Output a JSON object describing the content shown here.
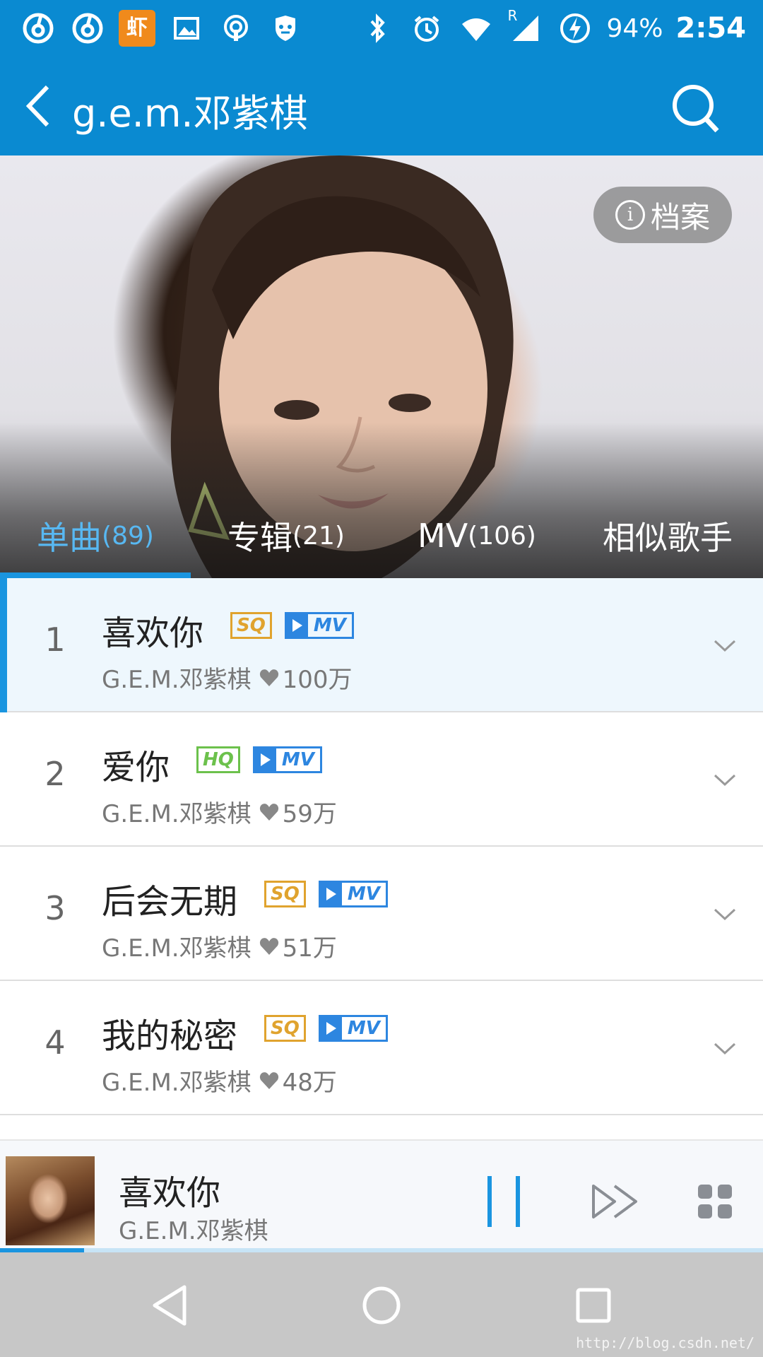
{
  "status_bar": {
    "left_icons": [
      "netease-music-icon",
      "netease-music-icon",
      "xiami-icon",
      "image-icon",
      "podcast-icon",
      "shield-icon"
    ],
    "xiami_label": "虾",
    "right_icons": [
      "bluetooth-icon",
      "alarm-icon",
      "wifi-icon",
      "signal-icon",
      "battery-charging-icon"
    ],
    "roaming": "R",
    "battery": "94%",
    "time": "2:54"
  },
  "header": {
    "title": "g.e.m.邓紫棋"
  },
  "hero": {
    "profile_label": "档案",
    "tabs": [
      {
        "name": "单曲",
        "count": "(89)",
        "active": true
      },
      {
        "name": "专辑",
        "count": "(21)",
        "active": false
      },
      {
        "name": "MV",
        "count": "(106)",
        "active": false
      },
      {
        "name": "相似歌手",
        "count": "",
        "active": false
      }
    ]
  },
  "songs": [
    {
      "num": "1",
      "title": "喜欢你",
      "quality": "SQ",
      "mv": "MV",
      "artist": "G.E.M.邓紫棋",
      "likes": "100万",
      "current": true
    },
    {
      "num": "2",
      "title": "爱你",
      "quality": "HQ",
      "mv": "MV",
      "artist": "G.E.M.邓紫棋",
      "likes": "59万",
      "current": false
    },
    {
      "num": "3",
      "title": "后会无期",
      "quality": "SQ",
      "mv": "MV",
      "artist": "G.E.M.邓紫棋",
      "likes": "51万",
      "current": false
    },
    {
      "num": "4",
      "title": "我的秘密",
      "quality": "SQ",
      "mv": "MV",
      "artist": "G.E.M.邓紫棋",
      "likes": "48万",
      "current": false
    }
  ],
  "player": {
    "title": "喜欢你",
    "artist": "G.E.M.邓紫棋",
    "progress": 0.11
  },
  "watermark": "http://blog.csdn.net/",
  "colors": {
    "brand": "#0a8ad1",
    "accent": "#1a95e0",
    "sq": "#e0a32e",
    "hq": "#6cc14c",
    "mv": "#2d86e0"
  }
}
